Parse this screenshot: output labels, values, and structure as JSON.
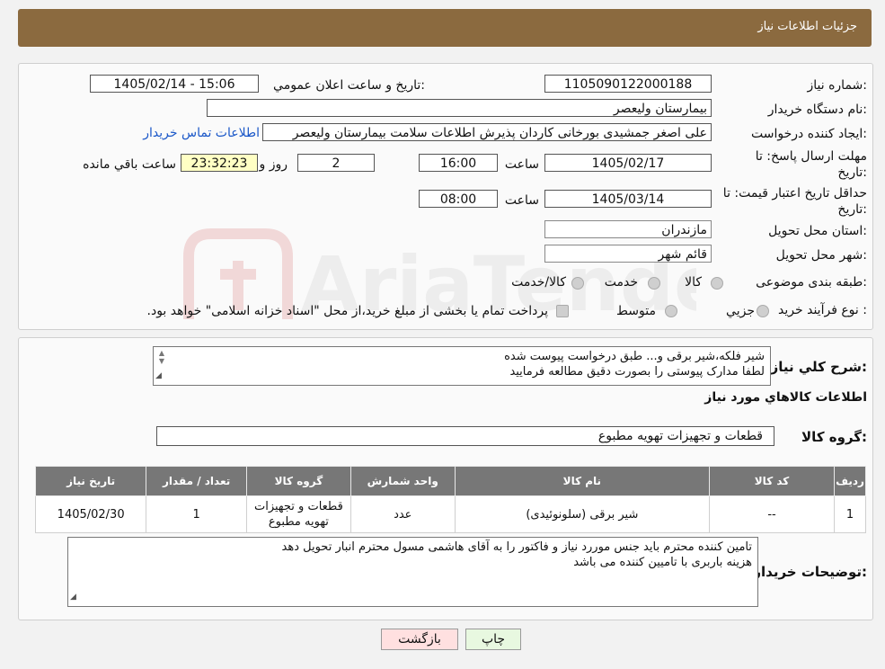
{
  "header": {
    "title": "جزئیات اطلاعات نیاز"
  },
  "info": {
    "need_number_label": "شماره نیاز:",
    "need_number": "1105090122000188",
    "announce_label": "تاریخ و ساعت اعلان عمومي:",
    "announce_value": "1405/02/14 - 15:06",
    "buyer_org_label": "نام دستگاه خريدار:",
    "buyer_org": "بیمارستان ولیعصر",
    "requester_label": "ایجاد کننده درخواست:",
    "requester": "علی اصغر جمشیدی بورخانی کاردان پذیرش اطلاعات سلامت بیمارستان ولیعصر",
    "contact_link": "اطلاعات تماس خریدار",
    "deadline_label_1": "مهلت ارسال پاسخ: تا",
    "deadline_label_2": "تاريخ:",
    "deadline_date": "1405/02/17",
    "time_label": "ساعت",
    "deadline_time": "16:00",
    "days_value": "2",
    "days_label": "روز و",
    "remaining_time": "23:32:23",
    "remaining_label": "ساعت باقي مانده",
    "validity_label_1": "حداقل تاريخ اعتبار قيمت: تا",
    "validity_label_2": "تاريخ:",
    "validity_date": "1405/03/14",
    "validity_time_label": "ساعت",
    "validity_time": "08:00",
    "province_label": "استان محل تحويل:",
    "province": "مازندران",
    "city_label": "شهر محل تحويل:",
    "city": "قائم شهر",
    "category_label": "طبقه بندی موضوعی:",
    "category_options": [
      "کالا",
      "خدمت",
      "کالا/خدمت"
    ],
    "purchase_type_label": "نوع فرآيند خريد :",
    "purchase_options": [
      "جزيي",
      "متوسط"
    ],
    "purchase_note": "پرداخت تمام یا بخشی از مبلغ خرید،از محل \"اسناد خزانه اسلامی\" خواهد بود."
  },
  "description": {
    "label": "شرح کلي نياز:",
    "line1": "شیر فلکه،شیر برقی و... طبق درخواست پیوست شده",
    "line2": "لطفا مدارک پیوستی را بصورت دقیق مطالعه فرمایید"
  },
  "goods": {
    "section_title": "اطلاعات کالاهاي مورد نياز",
    "group_label": "گروه کالا:",
    "group_value": "قطعات و تجهیزات تهویه مطبوع",
    "columns": [
      "رديف",
      "کد کالا",
      "نام کالا",
      "واحد شمارش",
      "گروه کالا",
      "تعداد / مقدار",
      "تاريخ نياز"
    ],
    "rows": [
      {
        "row": "1",
        "code": "--",
        "name": "شیر برقی (سلونوئیدی)",
        "unit": "عدد",
        "group": "قطعات و تجهیزات تهویه مطبوع",
        "qty": "1",
        "date": "1405/02/30"
      }
    ]
  },
  "buyer_notes": {
    "label": "توضيحات خريدار:",
    "line1": "تامین کننده محترم باید جنس موررد نیاز و فاکتور را به آقای هاشمی مسول محترم انبار تحویل دهد",
    "line2": "هزینه باربری با تامیین کننده می باشد"
  },
  "buttons": {
    "print": "چاپ",
    "back": "بازگشت"
  },
  "watermark_text": "AriaTender.neT",
  "colors": {
    "header": "#8b6a3f",
    "link": "#1a57c8",
    "print_btn": "#e8f8e0",
    "back_btn": "#ffe0e0"
  }
}
